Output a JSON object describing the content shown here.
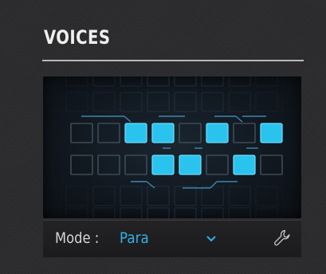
{
  "section": {
    "title": "VOICES"
  },
  "mode": {
    "label": "Mode :",
    "value": "Para"
  },
  "voices": {
    "active_color": "#29c3ee",
    "grid_color": "#2a3945",
    "link_color": "#3f86ad",
    "active_row1": [
      2,
      3,
      5,
      7
    ],
    "active_row2": [
      3,
      4,
      6
    ]
  },
  "icons": {
    "dropdown": "chevron-down-icon",
    "settings": "wrench-icon"
  }
}
